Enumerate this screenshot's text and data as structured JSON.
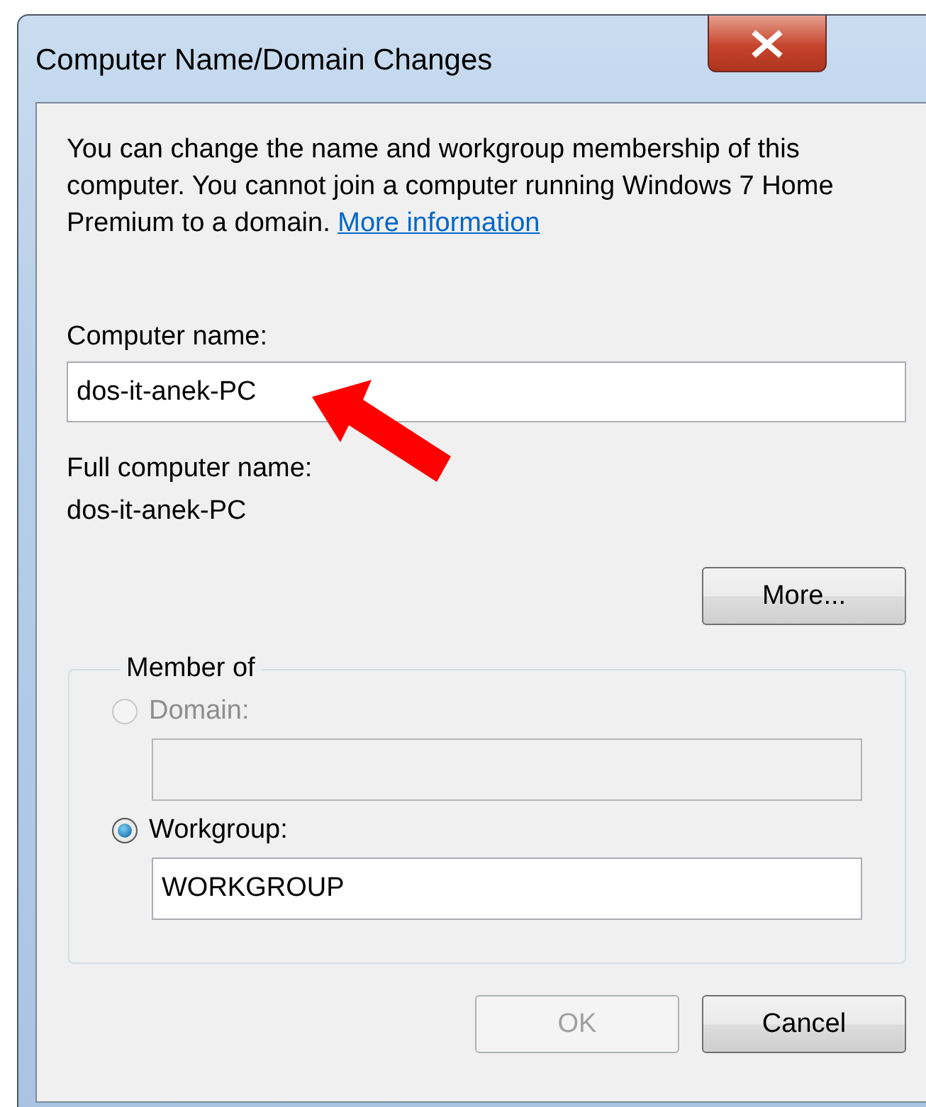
{
  "window": {
    "title": "Computer Name/Domain Changes"
  },
  "intro": {
    "text": "You can change the name and workgroup membership of this computer. You cannot join a computer running Windows 7 Home Premium to a domain.",
    "link": "More information"
  },
  "computer_name": {
    "label": "Computer name:",
    "value": "dos-it-anek-PC"
  },
  "full_name": {
    "label": "Full computer name:",
    "value": "dos-it-anek-PC"
  },
  "more_button": "More...",
  "member_of": {
    "title": "Member of",
    "options": [
      {
        "label": "Domain:",
        "selected": false,
        "disabled": true
      },
      {
        "label": "Workgroup:",
        "selected": true,
        "disabled": false,
        "value": "WORKGROUP"
      }
    ]
  },
  "buttons": [
    {
      "label": "OK",
      "disabled": true
    },
    {
      "label": "Cancel",
      "disabled": false
    }
  ]
}
